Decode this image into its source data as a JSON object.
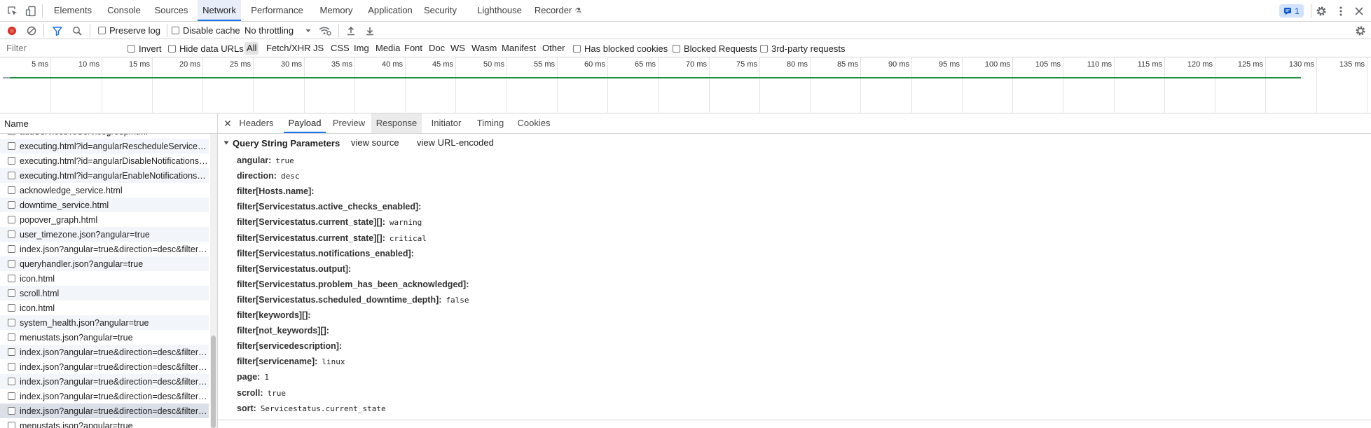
{
  "panel_tabs": [
    "Elements",
    "Console",
    "Sources",
    "Network",
    "Performance",
    "Memory",
    "Application",
    "Security",
    "Lighthouse",
    "Recorder"
  ],
  "active_panel": "Network",
  "issues_count": "1",
  "toolbar": {
    "preserve_log": "Preserve log",
    "disable_cache": "Disable cache",
    "throttling": "No throttling"
  },
  "filter": {
    "placeholder": "Filter",
    "invert": "Invert",
    "hide_data_urls": "Hide data URLs",
    "types": [
      "All",
      "Fetch/XHR",
      "JS",
      "CSS",
      "Img",
      "Media",
      "Font",
      "Doc",
      "WS",
      "Wasm",
      "Manifest",
      "Other"
    ],
    "active_type": "All",
    "has_blocked_cookies": "Has blocked cookies",
    "blocked_requests": "Blocked Requests",
    "third_party": "3rd-party requests"
  },
  "timeline": {
    "ticks": [
      "5 ms",
      "10 ms",
      "15 ms",
      "20 ms",
      "25 ms",
      "30 ms",
      "35 ms",
      "40 ms",
      "45 ms",
      "50 ms",
      "55 ms",
      "60 ms",
      "65 ms",
      "70 ms",
      "75 ms",
      "80 ms",
      "85 ms",
      "90 ms",
      "95 ms",
      "100 ms",
      "105 ms",
      "110 ms",
      "115 ms",
      "120 ms",
      "125 ms",
      "130 ms",
      "135 ms"
    ],
    "activity_end_ms": 128.5,
    "bar_color": "#1e8e3e"
  },
  "request_list": {
    "header": "Name",
    "rows": [
      "addServicesToServicegroup.html",
      "executing.html?id=angularRescheduleServiceModal",
      "executing.html?id=angularDisableNotificationsModal",
      "executing.html?id=angularEnableNotificationsModal",
      "acknowledge_service.html",
      "downtime_service.html",
      "popover_graph.html",
      "user_timezone.json?angular=true",
      "index.json?angular=true&direction=desc&filter%5B...",
      "queryhandler.json?angular=true",
      "icon.html",
      "scroll.html",
      "icon.html",
      "system_health.json?angular=true",
      "menustats.json?angular=true",
      "index.json?angular=true&direction=desc&filter%5B...",
      "index.json?angular=true&direction=desc&filter%5B...",
      "index.json?angular=true&direction=desc&filter%5B...",
      "index.json?angular=true&direction=desc&filter%5B...",
      "index.json?angular=true&direction=desc&filter%5B...",
      "menustats.json?angular=true"
    ],
    "selected_index": 19
  },
  "details": {
    "tabs": [
      "Headers",
      "Payload",
      "Preview",
      "Response",
      "Initiator",
      "Timing",
      "Cookies"
    ],
    "active_tab": "Payload",
    "hover_tab": "Response",
    "section_title": "Query String Parameters",
    "view_source": "view source",
    "view_url_encoded": "view URL-encoded",
    "params": [
      {
        "key": "angular:",
        "value": "true"
      },
      {
        "key": "direction:",
        "value": "desc"
      },
      {
        "key": "filter[Hosts.name]:",
        "value": ""
      },
      {
        "key": "filter[Servicestatus.active_checks_enabled]:",
        "value": ""
      },
      {
        "key": "filter[Servicestatus.current_state][]:",
        "value": "warning"
      },
      {
        "key": "filter[Servicestatus.current_state][]:",
        "value": "critical"
      },
      {
        "key": "filter[Servicestatus.notifications_enabled]:",
        "value": ""
      },
      {
        "key": "filter[Servicestatus.output]:",
        "value": ""
      },
      {
        "key": "filter[Servicestatus.problem_has_been_acknowledged]:",
        "value": ""
      },
      {
        "key": "filter[Servicestatus.scheduled_downtime_depth]:",
        "value": "false"
      },
      {
        "key": "filter[keywords][]:",
        "value": ""
      },
      {
        "key": "filter[not_keywords][]:",
        "value": ""
      },
      {
        "key": "filter[servicedescription]:",
        "value": ""
      },
      {
        "key": "filter[servicename]:",
        "value": "linux"
      },
      {
        "key": "page:",
        "value": "1"
      },
      {
        "key": "scroll:",
        "value": "true"
      },
      {
        "key": "sort:",
        "value": "Servicestatus.current_state"
      }
    ]
  }
}
